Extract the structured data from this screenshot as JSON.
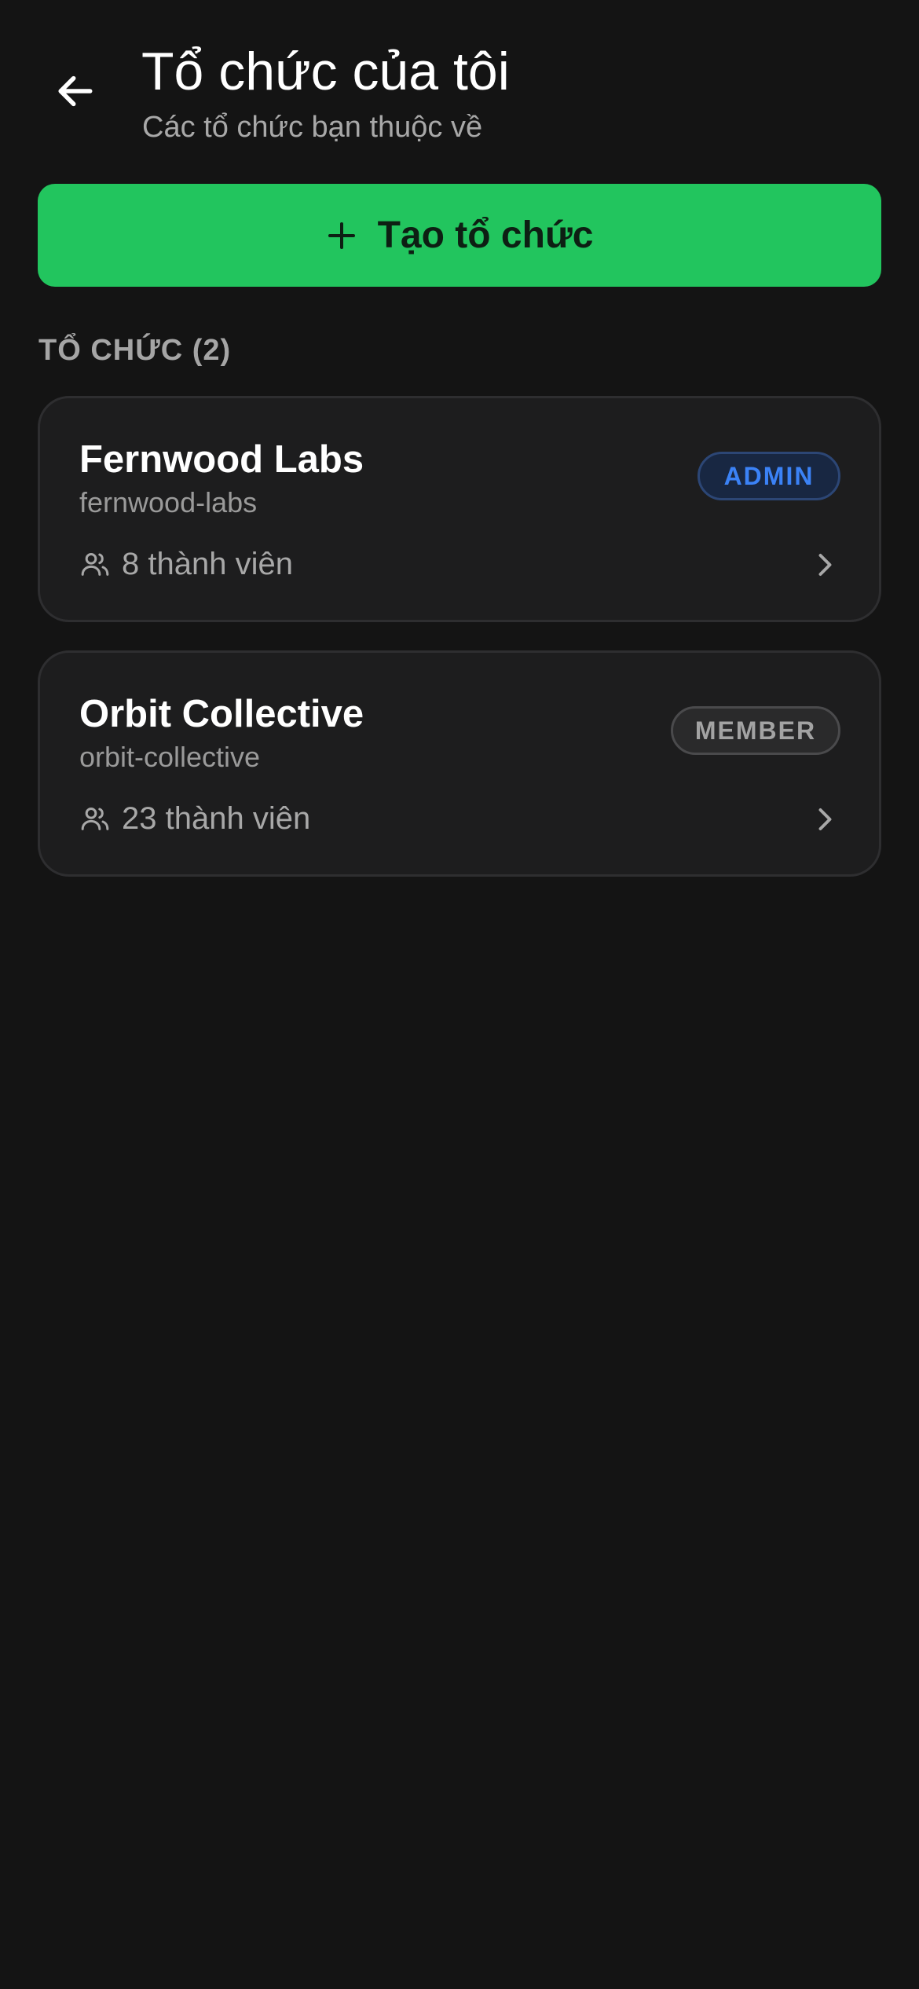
{
  "header": {
    "title": "Tổ chức của tôi",
    "subtitle": "Các tổ chức bạn thuộc về",
    "back_icon": "arrow-left-icon"
  },
  "create_button": {
    "label": "Tạo tổ chức",
    "icon": "plus-icon",
    "color": "#22c55e"
  },
  "section": {
    "label": "TỔ CHỨC (2)"
  },
  "organizations": [
    {
      "name": "Fernwood Labs",
      "slug": "fernwood-labs",
      "members": "8 thành viên",
      "role": "ADMIN",
      "role_color": "#3b82f6"
    },
    {
      "name": "Orbit Collective",
      "slug": "orbit-collective",
      "members": "23 thành viên",
      "role": "MEMBER",
      "role_color": "#a3a3a3"
    }
  ]
}
